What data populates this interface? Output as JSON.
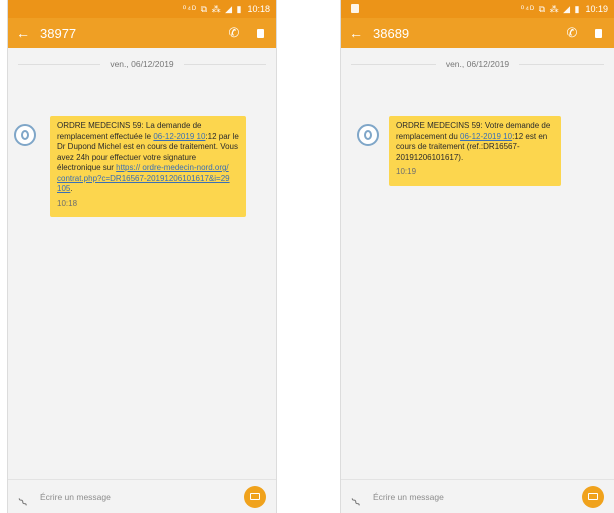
{
  "colors": {
    "accent": "#ef9f24",
    "bubble": "#fcd64e",
    "link": "#3a6fb5"
  },
  "left": {
    "status": {
      "icons": "⁰⁴ᴰ ⧉ ⁂ ◢ ▮",
      "time": "10:18"
    },
    "contact": "38977",
    "date": "ven., 06/12/2019",
    "message": {
      "p1": "ORDRE MEDECINS 59: La demande de remplacement effectuée le ",
      "link_date": "06-12-2019 10",
      "p2": ":12 par  le Dr Dupond Michel est en cours de traitement. Vous avez 24h pour effectuer votre signature électronique sur ",
      "link_url": "https:// ordre-medecin-nord.org/ contrat.php?c=DR16567-20191206101617&i=29 105",
      "p3": "."
    },
    "time": "10:18",
    "composer_placeholder": "Écrire un message"
  },
  "right": {
    "status": {
      "icons": "⁰⁴ᴰ ⧉ ⁂ ◢ ▮",
      "time": "10:19"
    },
    "contact": "38689",
    "date": "ven., 06/12/2019",
    "message": {
      "p1": "ORDRE MEDECINS 59: Votre demande de remplacement du ",
      "link_date": "06-12-2019 10",
      "p2": ":12 est en cours de traitement (ref.:DR16567-20191206101617)."
    },
    "time": "10:19",
    "composer_placeholder": "Écrire un message"
  },
  "icons": {
    "back": "back-arrow-icon",
    "call": "phone-icon",
    "delete": "trash-icon",
    "attach": "paperclip-icon",
    "send": "send-icon",
    "avatar": "contact-avatar-icon"
  }
}
